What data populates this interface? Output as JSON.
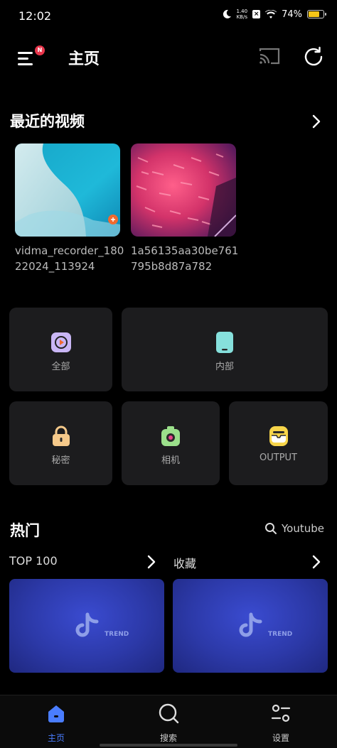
{
  "status_bar": {
    "time": "12:02",
    "net_speed_value": "1.40",
    "net_speed_unit": "KB/s",
    "battery": "74%",
    "battery_level": 0.74
  },
  "appbar": {
    "title": "主页",
    "menu_badge": "N"
  },
  "recent": {
    "title": "最近的视频",
    "videos": [
      {
        "name": "vidma_recorder_18022024_113924"
      },
      {
        "name": "1a56135aa30be761795b8d87a782"
      }
    ]
  },
  "folders": [
    {
      "label": "全部",
      "icon": "play-icon"
    },
    {
      "label": "内部",
      "icon": "phone-icon"
    },
    {
      "label": "秘密",
      "icon": "lock-icon"
    },
    {
      "label": "相机",
      "icon": "camera-icon"
    },
    {
      "label": "OUTPUT",
      "icon": "inbox-icon"
    }
  ],
  "hot": {
    "title": "热门",
    "search_label": "Youtube",
    "lists": [
      {
        "label": "TOP 100",
        "card_text": "TREND"
      },
      {
        "label": "收藏",
        "card_text": "TREND"
      }
    ]
  },
  "bottom_nav": [
    {
      "label": "主页",
      "icon": "home-icon",
      "active": true
    },
    {
      "label": "搜索",
      "icon": "search-icon",
      "active": false
    },
    {
      "label": "设置",
      "icon": "settings-icon",
      "active": false
    }
  ],
  "colors": {
    "background": "#000000",
    "tile": "#1c1c1e",
    "accent": "#4a7dff",
    "badge": "#e8364c"
  }
}
